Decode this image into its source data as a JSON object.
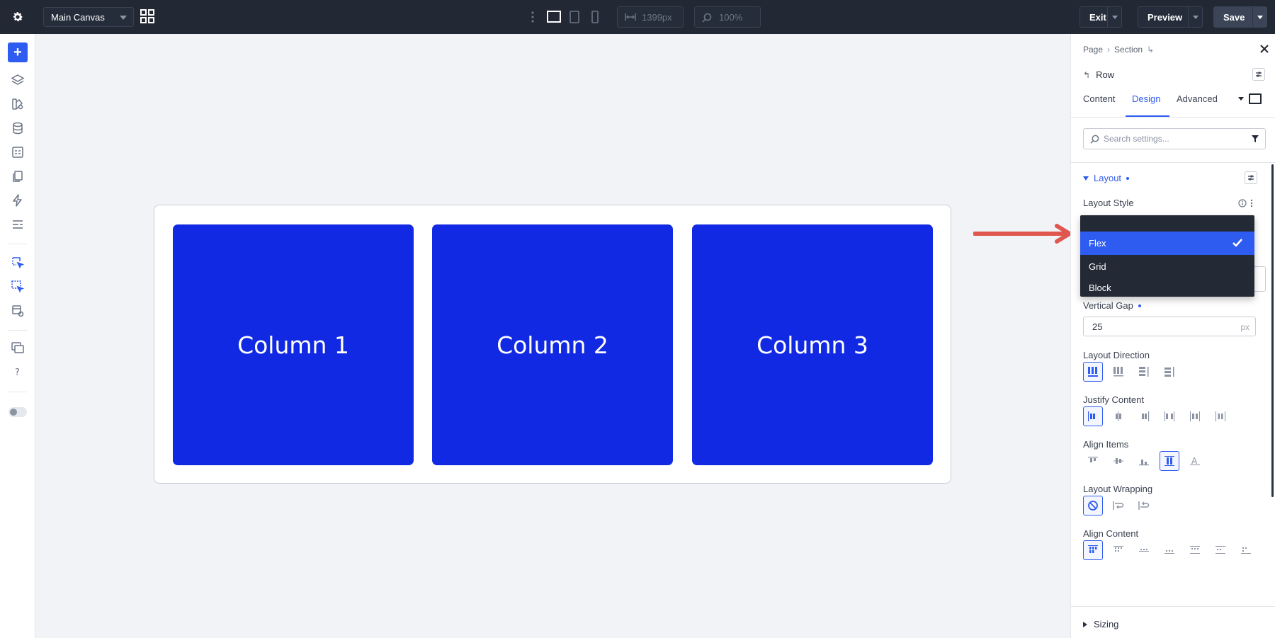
{
  "topbar": {
    "canvas_name": "Main Canvas",
    "width_value": "1399px",
    "zoom_value": "100%",
    "exit_label": "Exit",
    "preview_label": "Preview",
    "save_label": "Save"
  },
  "canvas": {
    "columns": [
      {
        "label": "Column 1"
      },
      {
        "label": "Column 2"
      },
      {
        "label": "Column 3"
      }
    ],
    "column_color": "#1129e3",
    "arrow_color": "#e0574f"
  },
  "panel": {
    "breadcrumb": [
      "Page",
      "Section"
    ],
    "element_title": "Row",
    "tabs": [
      {
        "label": "Content"
      },
      {
        "label": "Design"
      },
      {
        "label": "Advanced"
      }
    ],
    "active_tab": "Design",
    "search_placeholder": "Search settings...",
    "layout_section": {
      "title": "Layout",
      "layout_style_label": "Layout Style",
      "layout_style_options": [
        {
          "label": "Flex"
        },
        {
          "label": "Grid"
        },
        {
          "label": "Block"
        }
      ],
      "selected_option": "Flex",
      "vertical_gap_label": "Vertical Gap",
      "vertical_gap_value": "25",
      "vertical_gap_unit": "px",
      "layout_direction_label": "Layout Direction",
      "justify_content_label": "Justify Content",
      "align_items_label": "Align Items",
      "layout_wrapping_label": "Layout Wrapping",
      "align_content_label": "Align Content"
    },
    "sizing_section": {
      "title": "Sizing"
    }
  },
  "accent_color": "#2f5cf0"
}
